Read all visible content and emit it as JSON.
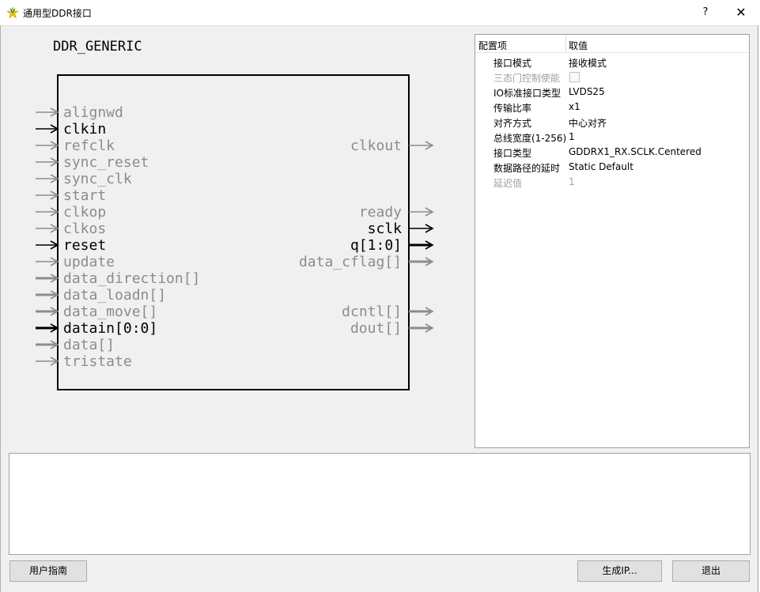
{
  "window": {
    "title": "通用型DDR接口",
    "help_label": "?",
    "close_label": "✕",
    "icon": "app-logo-icon"
  },
  "symbol": {
    "module_name": "DDR_GENERIC",
    "inputs": [
      {
        "name": "alignwd",
        "active": false,
        "bus": false
      },
      {
        "name": "clkin",
        "active": true,
        "bus": false
      },
      {
        "name": "refclk",
        "active": false,
        "bus": false
      },
      {
        "name": "sync_reset",
        "active": false,
        "bus": false
      },
      {
        "name": "sync_clk",
        "active": false,
        "bus": false
      },
      {
        "name": "start",
        "active": false,
        "bus": false
      },
      {
        "name": "clkop",
        "active": false,
        "bus": false
      },
      {
        "name": "clkos",
        "active": false,
        "bus": false
      },
      {
        "name": "reset",
        "active": true,
        "bus": false
      },
      {
        "name": "update",
        "active": false,
        "bus": false
      },
      {
        "name": "data_direction[]",
        "active": false,
        "bus": true
      },
      {
        "name": "data_loadn[]",
        "active": false,
        "bus": true
      },
      {
        "name": "data_move[]",
        "active": false,
        "bus": true
      },
      {
        "name": "datain[0:0]",
        "active": true,
        "bus": true
      },
      {
        "name": "data[]",
        "active": false,
        "bus": true
      },
      {
        "name": "tristate",
        "active": false,
        "bus": false
      }
    ],
    "outputs": [
      {
        "name": "clkout",
        "row": 2,
        "active": false,
        "bus": false
      },
      {
        "name": "ready",
        "row": 6,
        "active": false,
        "bus": false
      },
      {
        "name": "sclk",
        "row": 7,
        "active": true,
        "bus": false
      },
      {
        "name": "q[1:0]",
        "row": 8,
        "active": true,
        "bus": true
      },
      {
        "name": "data_cflag[]",
        "row": 9,
        "active": false,
        "bus": true
      },
      {
        "name": "dcntl[]",
        "row": 12,
        "active": false,
        "bus": true
      },
      {
        "name": "dout[]",
        "row": 13,
        "active": false,
        "bus": true
      }
    ],
    "colors": {
      "active": "#000000",
      "inactive": "#8c8c8c"
    }
  },
  "properties": {
    "header_key": "配置项",
    "header_value": "取值",
    "rows": [
      {
        "key": "接口模式",
        "value": "接收模式",
        "disabled": false,
        "checkbox": false
      },
      {
        "key": "三态门控制使能",
        "value": "",
        "disabled": true,
        "checkbox": true
      },
      {
        "key": "IO标准接口类型",
        "value": "LVDS25",
        "disabled": false,
        "checkbox": false
      },
      {
        "key": "传输比率",
        "value": "x1",
        "disabled": false,
        "checkbox": false
      },
      {
        "key": "对齐方式",
        "value": "中心对齐",
        "disabled": false,
        "checkbox": false
      },
      {
        "key": "总线宽度(1-256)",
        "value": "1",
        "disabled": false,
        "checkbox": false
      },
      {
        "key": "接口类型",
        "value": "GDDRX1_RX.SCLK.Centered",
        "disabled": false,
        "checkbox": false
      },
      {
        "key": "数据路径的延时",
        "value": "Static Default",
        "disabled": false,
        "checkbox": false
      },
      {
        "key": "延迟值",
        "value": "1",
        "disabled": true,
        "checkbox": false
      }
    ]
  },
  "console": {
    "text": ""
  },
  "buttons": {
    "user_guide": "用户指南",
    "generate": "生成IP...",
    "exit": "退出"
  }
}
